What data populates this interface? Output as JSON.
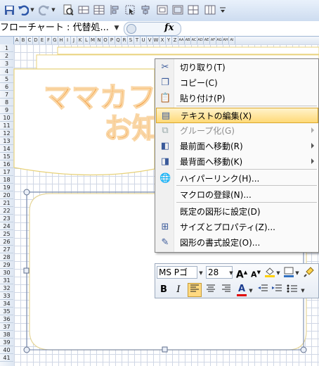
{
  "quick_access": {
    "icons": [
      "save-icon",
      "undo-icon",
      "dropdown-arrow-icon",
      "redo-icon",
      "dropdown-arrow-icon",
      "print-preview-icon",
      "grid-icon",
      "table-icon",
      "align-icon",
      "pointer-icon",
      "align-icon",
      "frame-icon",
      "grid-icon",
      "columns-icon",
      "customize-toolbar-icon"
    ]
  },
  "formula_bar": {
    "name_box": "フローチャート : 代替処...",
    "fx": "fx"
  },
  "columns": [
    "A",
    "B",
    "C",
    "D",
    "E",
    "F",
    "G",
    "H",
    "I",
    "J",
    "K",
    "L",
    "M",
    "N",
    "O",
    "P",
    "Q",
    "R",
    "S",
    "T",
    "U",
    "V",
    "W",
    "X",
    "Y",
    "Z",
    "AA",
    "AB",
    "AC",
    "AD",
    "AE",
    "AF",
    "AG",
    "AH",
    "AI"
  ],
  "rows": [
    "1",
    "2",
    "3",
    "4",
    "5",
    "6",
    "7",
    "8",
    "9",
    "10",
    "11",
    "12",
    "13",
    "14",
    "15",
    "16",
    "17",
    "18",
    "19",
    "20",
    "21",
    "22",
    "23",
    "24",
    "25",
    "26",
    "27",
    "28",
    "29",
    "30",
    "31",
    "32",
    "33",
    "34",
    "35",
    "36",
    "37",
    "38",
    "39",
    "40",
    "41"
  ],
  "banner": {
    "line1": "ママカフェ",
    "line2": "お知"
  },
  "context_menu": {
    "items": [
      {
        "label": "切り取り(T)",
        "icon": "scissors-icon",
        "disabled": false,
        "submenu": false
      },
      {
        "label": "コピー(C)",
        "icon": "copy-icon",
        "disabled": false,
        "submenu": false
      },
      {
        "label": "貼り付け(P)",
        "icon": "paste-icon",
        "disabled": false,
        "submenu": false
      },
      {
        "label": "テキストの編集(X)",
        "icon": "edit-text-icon",
        "disabled": false,
        "submenu": false,
        "highlighted": true
      },
      {
        "label": "グループ化(G)",
        "icon": "group-icon",
        "disabled": true,
        "submenu": true
      },
      {
        "label": "最前面へ移動(R)",
        "icon": "bring-front-icon",
        "disabled": false,
        "submenu": true
      },
      {
        "label": "最背面へ移動(K)",
        "icon": "send-back-icon",
        "disabled": false,
        "submenu": true
      },
      {
        "label": "ハイパーリンク(H)...",
        "icon": "hyperlink-icon",
        "disabled": false,
        "submenu": false
      },
      {
        "label": "マクロの登録(N)...",
        "icon": "",
        "disabled": false,
        "submenu": false
      },
      {
        "label": "既定の図形に設定(D)",
        "icon": "",
        "disabled": false,
        "submenu": false
      },
      {
        "label": "サイズとプロパティ(Z)...",
        "icon": "size-icon",
        "disabled": false,
        "submenu": false
      },
      {
        "label": "図形の書式設定(O)...",
        "icon": "format-shape-icon",
        "disabled": false,
        "submenu": false
      }
    ]
  },
  "mini_toolbar": {
    "font": "MS Pゴ",
    "size": "28",
    "grow": "A",
    "shrink": "A",
    "bold": "B",
    "italic": "I",
    "font_color_letter": "A"
  }
}
